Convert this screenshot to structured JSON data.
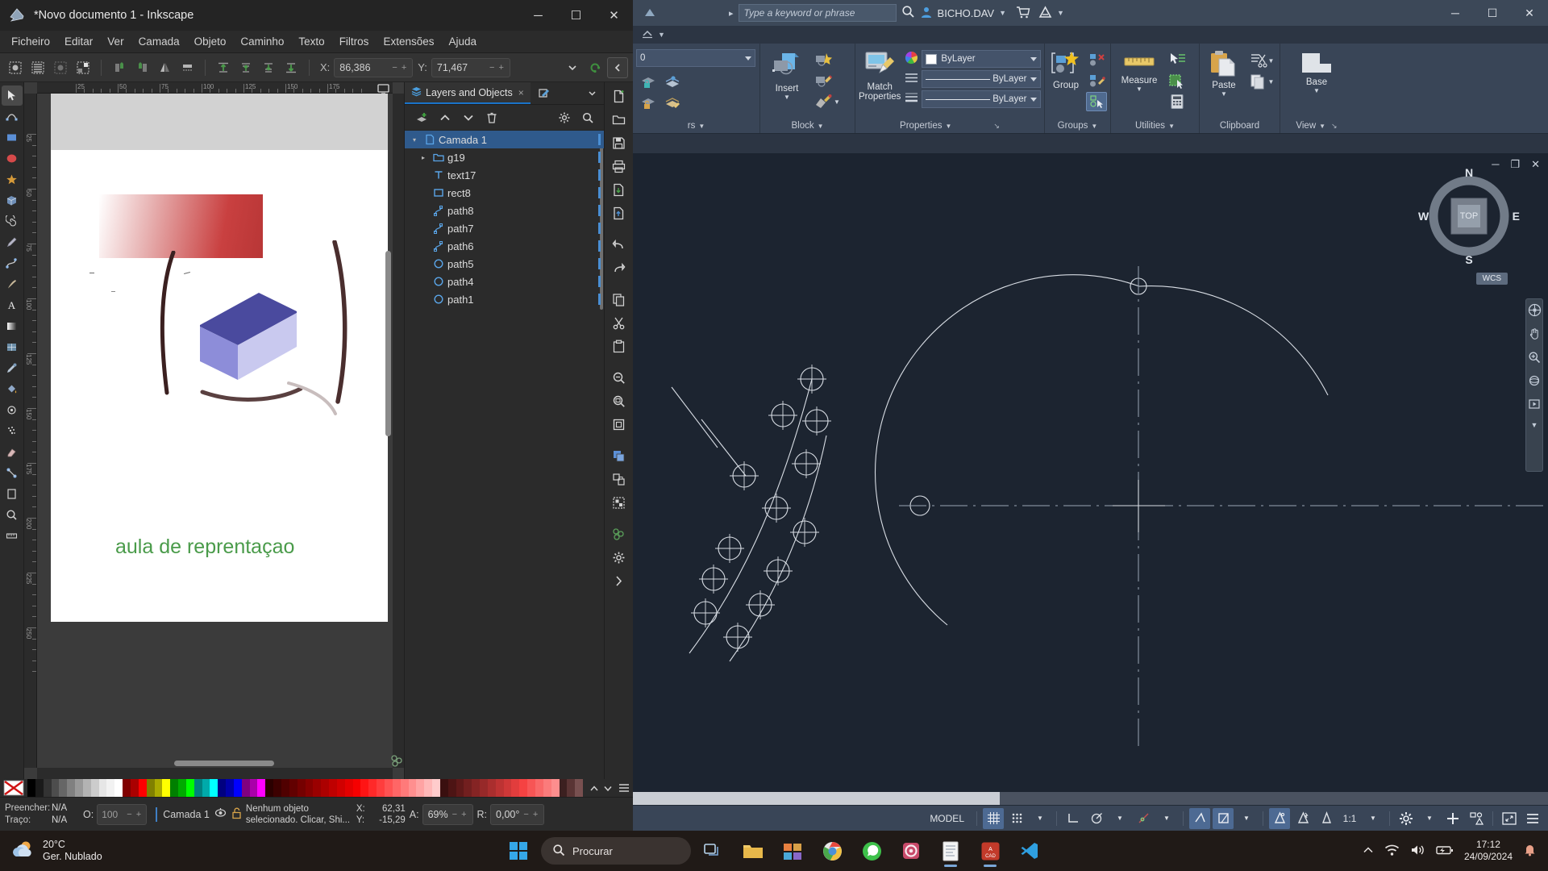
{
  "inkscape": {
    "title": "*Novo documento 1 - Inkscape",
    "window_buttons": {
      "minimize": "─",
      "maximize": "☐",
      "close": "✕"
    },
    "menu": [
      "Ficheiro",
      "Editar",
      "Ver",
      "Camada",
      "Objeto",
      "Caminho",
      "Texto",
      "Filtros",
      "Extensões",
      "Ajuda"
    ],
    "toolbar": {
      "x_label": "X:",
      "x_value": "86,386",
      "y_label": "Y:",
      "y_value": "71,467",
      "spinner": "− +"
    },
    "ruler": {
      "h_ticks": [
        "25",
        "50",
        "75",
        "100",
        "125",
        "150",
        "175"
      ],
      "v_ticks": [
        "25",
        "50",
        "75",
        "100",
        "125",
        "150",
        "175",
        "200",
        "225",
        "250"
      ]
    },
    "canvas": {
      "text_object": "aula de reprentaçao",
      "text_color": "#4a9b4a"
    },
    "dock": {
      "tab_label": "Layers and Objects",
      "tab_close": "×",
      "tools": [
        "add-layer",
        "raise",
        "lower",
        "delete",
        "settings",
        "search"
      ],
      "layers": [
        {
          "label": "Camada 1",
          "icon": "layer-icon",
          "selected": true,
          "indent": 0,
          "expander": "▾"
        },
        {
          "label": "g19",
          "icon": "group-icon",
          "selected": false,
          "indent": 1,
          "expander": "▸"
        },
        {
          "label": "text17",
          "icon": "text-icon",
          "selected": false,
          "indent": 1,
          "expander": ""
        },
        {
          "label": "rect8",
          "icon": "rect-icon",
          "selected": false,
          "indent": 1,
          "expander": ""
        },
        {
          "label": "path8",
          "icon": "path-icon",
          "selected": false,
          "indent": 1,
          "expander": ""
        },
        {
          "label": "path7",
          "icon": "path-icon",
          "selected": false,
          "indent": 1,
          "expander": ""
        },
        {
          "label": "path6",
          "icon": "path-icon",
          "selected": false,
          "indent": 1,
          "expander": ""
        },
        {
          "label": "path5",
          "icon": "ellipse-icon",
          "selected": false,
          "indent": 1,
          "expander": ""
        },
        {
          "label": "path4",
          "icon": "ellipse-icon",
          "selected": false,
          "indent": 1,
          "expander": ""
        },
        {
          "label": "path1",
          "icon": "ellipse-icon",
          "selected": false,
          "indent": 1,
          "expander": ""
        }
      ]
    },
    "status": {
      "fill_label": "Preencher:",
      "fill_value": "N/A",
      "stroke_label": "Traço:",
      "stroke_value": "N/A",
      "opacity_label": "O:",
      "opacity_value": "100",
      "layer_name": "Camada 1",
      "message_line1": "Nenhum objeto",
      "message_line2": "selecionado. Clicar, Shi...",
      "x_label": "X:",
      "x_value": "62,31",
      "y_label": "Y:",
      "y_value": "-15,29",
      "zoom_label": "A:",
      "zoom_value": "69%",
      "rotation_label": "R:",
      "rotation_value": "0,00°",
      "minus": "−",
      "plus": "+"
    },
    "palette_colors": [
      "#000000",
      "#1a1a1a",
      "#333333",
      "#4d4d4d",
      "#666666",
      "#808080",
      "#999999",
      "#b3b3b3",
      "#cccccc",
      "#e6e6e6",
      "#f2f2f2",
      "#ffffff",
      "#800000",
      "#aa0000",
      "#ff0000",
      "#808000",
      "#aaaa00",
      "#ffff00",
      "#008000",
      "#00aa00",
      "#00ff00",
      "#008080",
      "#00aaaa",
      "#00ffff",
      "#000080",
      "#0000aa",
      "#0000ff",
      "#800080",
      "#aa00aa",
      "#ff00ff",
      "#2b0000",
      "#3d0000",
      "#500000",
      "#620000",
      "#750000",
      "#870000",
      "#9a0000",
      "#ac0000",
      "#bf0000",
      "#d10000",
      "#e40000",
      "#f60000",
      "#ff1414",
      "#ff2929",
      "#ff3d3d",
      "#ff5252",
      "#ff6666",
      "#ff7a7a",
      "#ff8f8f",
      "#ffa3a3",
      "#ffb8b8",
      "#ffcccc",
      "#3a0f0f",
      "#4d1414",
      "#5f1919",
      "#721f1f",
      "#852424",
      "#972929",
      "#aa2e2e",
      "#bd3333",
      "#cf3838",
      "#e23d3d",
      "#f54242",
      "#f75555",
      "#f96868",
      "#fb7b7b",
      "#fd8e8e",
      "#3c2020",
      "#5a3434",
      "#785050"
    ]
  },
  "autocad": {
    "titlebar": {
      "search_placeholder": "Type a keyword or phrase",
      "user": "BICHO.DAV",
      "expand_arrow": "▸"
    },
    "window_buttons": {
      "minimize": "─",
      "maximize": "☐",
      "close": "✕"
    },
    "ribbon": {
      "layer_combo_value": "0",
      "panels": [
        {
          "title": "Layers",
          "title_display": "rs"
        },
        {
          "title": "Block",
          "title_display": "Block",
          "main_label": "Insert"
        },
        {
          "title": "Properties",
          "title_display": "Properties",
          "main_label": "Match\nProperties",
          "combos": [
            "ByLayer",
            "ByLayer",
            "ByLayer"
          ]
        },
        {
          "title": "Groups",
          "title_display": "Groups",
          "main_label": "Group"
        },
        {
          "title": "Utilities",
          "title_display": "Utilities",
          "main_label": "Measure"
        },
        {
          "title": "Clipboard",
          "title_display": "Clipboard",
          "main_label": "Paste"
        },
        {
          "title": "View",
          "title_display": "View",
          "main_label": "Base"
        }
      ],
      "match_properties_label": "Match",
      "match_properties_label2": "Properties",
      "insert_label": "Insert",
      "group_label": "Group",
      "measure_label": "Measure",
      "paste_label": "Paste",
      "base_label": "Base"
    },
    "viewport": {
      "viewcube": {
        "top": "TOP",
        "north": "N",
        "south": "S",
        "east": "E",
        "west": "W"
      },
      "wcs_label": "WCS",
      "window_buttons": {
        "minimize": "─",
        "restore": "❐",
        "close": "✕"
      }
    },
    "status": {
      "model_label": "MODEL",
      "scale_label": "1:1",
      "toggles": [
        "grid",
        "snap",
        "ortho-constraint",
        "polar",
        "isometric",
        "object-snap",
        "annotation",
        "osnap-tracking",
        "selection-cycling"
      ]
    }
  },
  "taskbar": {
    "weather_temp": "20°C",
    "weather_desc": "Ger. Nublado",
    "search_placeholder": "Procurar",
    "apps": [
      "task-view",
      "file-explorer",
      "store",
      "chrome",
      "whatsapp",
      "photos",
      "word",
      "autocad",
      "vscode"
    ],
    "time": "17:12",
    "date": "24/09/2024"
  }
}
